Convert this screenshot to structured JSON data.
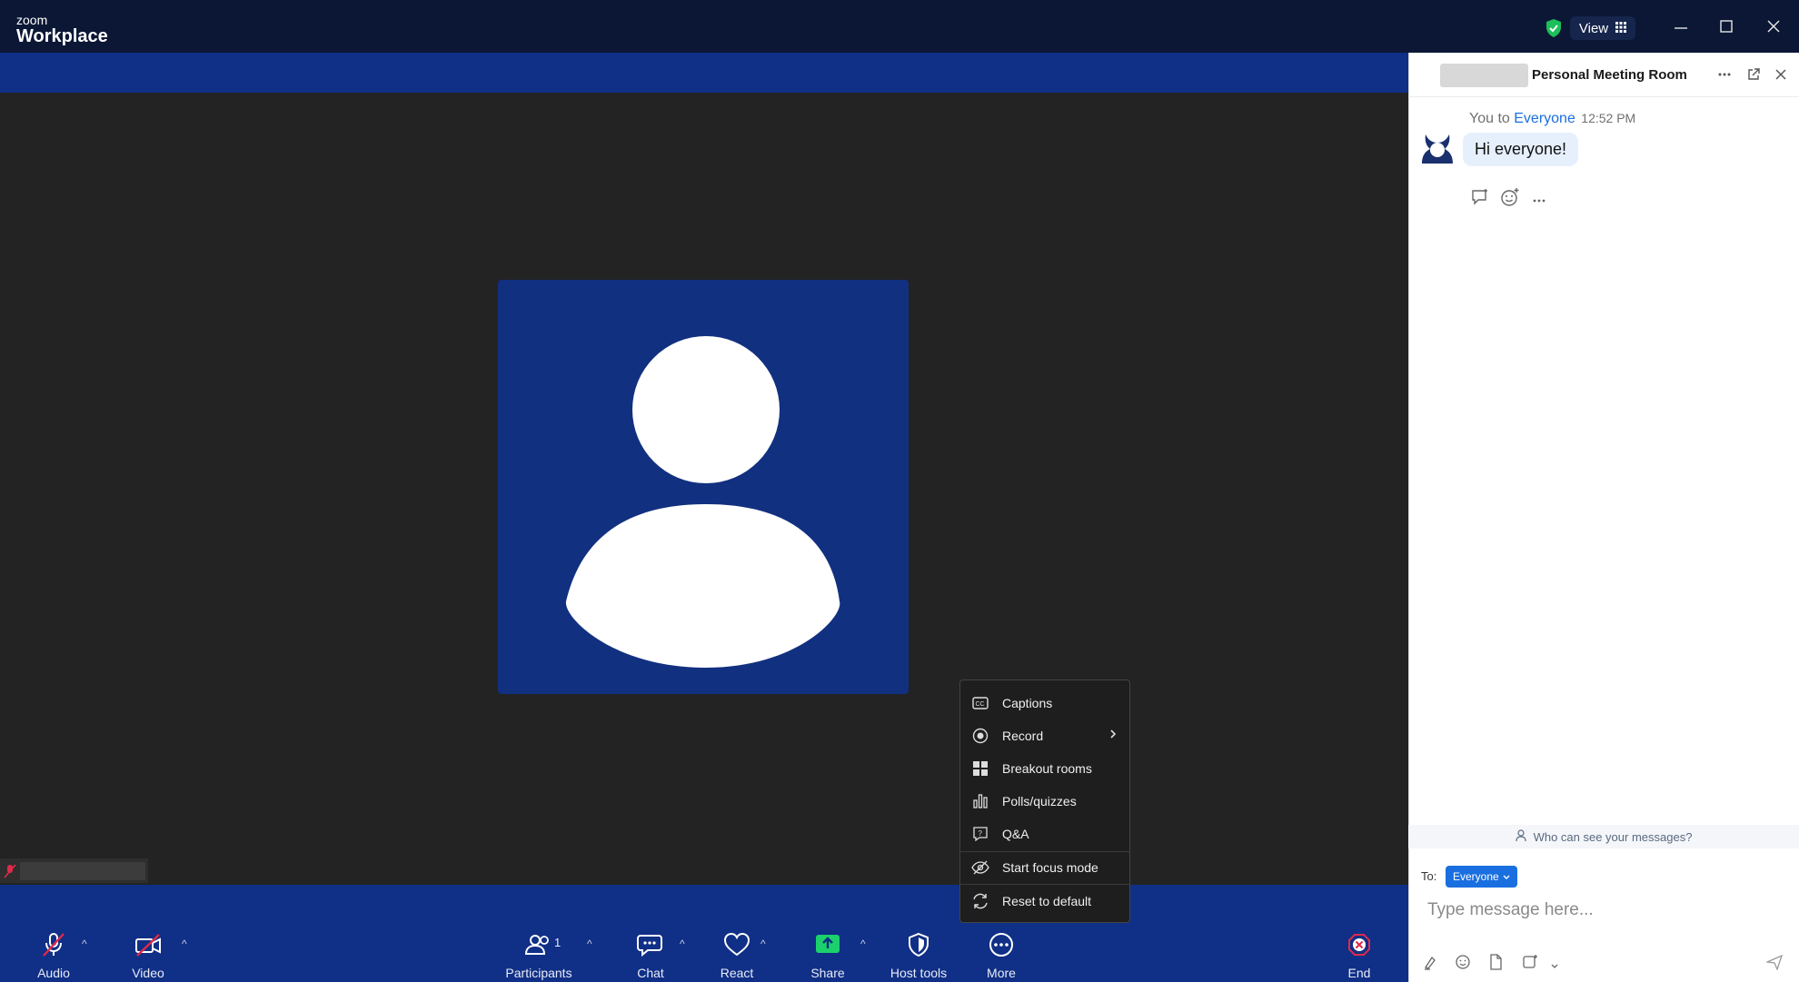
{
  "app": {
    "brand_small": "zoom",
    "brand_big": "Workplace",
    "view_label": "View"
  },
  "toolbar": {
    "audio": "Audio",
    "video": "Video",
    "participants": "Participants",
    "participants_count": "1",
    "chat": "Chat",
    "react": "React",
    "share": "Share",
    "host_tools": "Host tools",
    "more": "More",
    "end": "End"
  },
  "more_menu": {
    "items": [
      "Captions",
      "Record",
      "Breakout rooms",
      "Polls/quizzes",
      "Q&A",
      "Start focus mode",
      "Reset to default"
    ]
  },
  "chat": {
    "title": "Personal Meeting Room",
    "message": {
      "sender": "You to",
      "recipient": "Everyone",
      "time": "12:52 PM",
      "text": "Hi everyone!"
    },
    "who_can_see": "Who can see your messages?",
    "to_label": "To:",
    "to_value": "Everyone",
    "placeholder": "Type message here..."
  },
  "colors": {
    "titlebar": "#0b1735",
    "brandbar": "#102f86",
    "stage": "#232323",
    "accent": "#1a6fe0",
    "share_green": "#1bd16b",
    "end_red": "#e02a4b"
  }
}
